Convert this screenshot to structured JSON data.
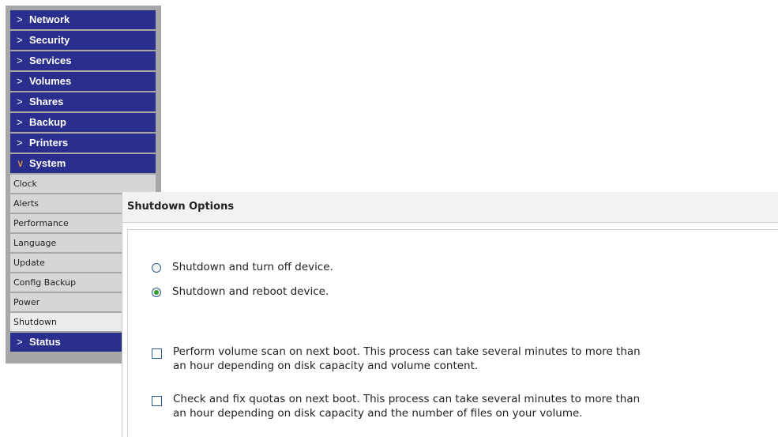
{
  "sidebar": {
    "menu": [
      {
        "label": "Network"
      },
      {
        "label": "Security"
      },
      {
        "label": "Services"
      },
      {
        "label": "Volumes"
      },
      {
        "label": "Shares"
      },
      {
        "label": "Backup"
      },
      {
        "label": "Printers"
      },
      {
        "label": "System"
      }
    ],
    "system_items": [
      "Clock",
      "Alerts",
      "Performance",
      "Language",
      "Update",
      "Config Backup",
      "Power",
      "Shutdown"
    ],
    "status_label": "Status",
    "chevron_closed": ">",
    "chevron_open": "∨"
  },
  "panel": {
    "title": "Shutdown Options",
    "radio_off_label": "Shutdown and turn off device.",
    "radio_reboot_label": "Shutdown and reboot device.",
    "check_volume_scan_label": "Perform volume scan on next boot. This process can take several minutes to more than\nan hour depending on disk capacity and volume content.",
    "check_quotas_label": "Check and fix quotas on next boot. This process can take several minutes to more than\nan hour depending on disk capacity and the number of files on your volume.",
    "selected_option": "reboot"
  },
  "colors": {
    "nav_bg": "#2a2f8e",
    "sidebar_frame": "#a7a7a7",
    "sub_bg": "#d6d6d6",
    "radio_dot": "#2ca22c"
  }
}
